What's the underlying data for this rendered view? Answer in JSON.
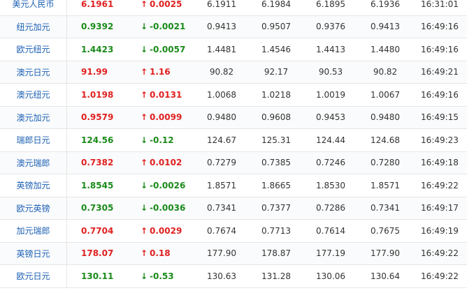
{
  "colors": {
    "up": "#e02020",
    "down": "#1a8a1a",
    "link": "#1a5fb4"
  },
  "icons": {
    "up": "arrow-up-icon",
    "down": "arrow-down-icon"
  },
  "rows": [
    {
      "name": "美元人民币",
      "price": "6.1961",
      "change": "0.0025",
      "dir": "up",
      "v1": "6.1911",
      "v2": "6.1984",
      "v3": "6.1895",
      "v4": "6.1936",
      "time": "16:31:01"
    },
    {
      "name": "纽元加元",
      "price": "0.9392",
      "change": "-0.0021",
      "dir": "down",
      "v1": "0.9413",
      "v2": "0.9507",
      "v3": "0.9376",
      "v4": "0.9413",
      "time": "16:49:16"
    },
    {
      "name": "欧元纽元",
      "price": "1.4423",
      "change": "-0.0057",
      "dir": "down",
      "v1": "1.4481",
      "v2": "1.4546",
      "v3": "1.4413",
      "v4": "1.4480",
      "time": "16:49:16"
    },
    {
      "name": "澳元日元",
      "price": "91.99",
      "change": "1.16",
      "dir": "up",
      "v1": "90.82",
      "v2": "92.17",
      "v3": "90.53",
      "v4": "90.82",
      "time": "16:49:21"
    },
    {
      "name": "澳元纽元",
      "price": "1.0198",
      "change": "0.0131",
      "dir": "up",
      "v1": "1.0068",
      "v2": "1.0218",
      "v3": "1.0019",
      "v4": "1.0067",
      "time": "16:49:16"
    },
    {
      "name": "澳元加元",
      "price": "0.9579",
      "change": "0.0099",
      "dir": "up",
      "v1": "0.9480",
      "v2": "0.9608",
      "v3": "0.9453",
      "v4": "0.9480",
      "time": "16:49:15"
    },
    {
      "name": "瑞郎日元",
      "price": "124.56",
      "change": "-0.12",
      "dir": "down",
      "v1": "124.67",
      "v2": "125.31",
      "v3": "124.44",
      "v4": "124.68",
      "time": "16:49:23"
    },
    {
      "name": "澳元瑞郎",
      "price": "0.7382",
      "change": "0.0102",
      "dir": "up",
      "v1": "0.7279",
      "v2": "0.7385",
      "v3": "0.7246",
      "v4": "0.7280",
      "time": "16:49:18"
    },
    {
      "name": "英镑加元",
      "price": "1.8545",
      "change": "-0.0026",
      "dir": "down",
      "v1": "1.8571",
      "v2": "1.8665",
      "v3": "1.8530",
      "v4": "1.8571",
      "time": "16:49:22"
    },
    {
      "name": "欧元英镑",
      "price": "0.7305",
      "change": "-0.0036",
      "dir": "down",
      "v1": "0.7341",
      "v2": "0.7377",
      "v3": "0.7286",
      "v4": "0.7341",
      "time": "16:49:17"
    },
    {
      "name": "加元瑞郎",
      "price": "0.7704",
      "change": "0.0029",
      "dir": "up",
      "v1": "0.7674",
      "v2": "0.7713",
      "v3": "0.7614",
      "v4": "0.7675",
      "time": "16:49:19"
    },
    {
      "name": "英镑日元",
      "price": "178.07",
      "change": "0.18",
      "dir": "up",
      "v1": "177.90",
      "v2": "178.87",
      "v3": "177.19",
      "v4": "177.90",
      "time": "16:49:22"
    },
    {
      "name": "欧元日元",
      "price": "130.11",
      "change": "-0.53",
      "dir": "down",
      "v1": "130.63",
      "v2": "131.28",
      "v3": "130.06",
      "v4": "130.64",
      "time": "16:49:22"
    }
  ]
}
